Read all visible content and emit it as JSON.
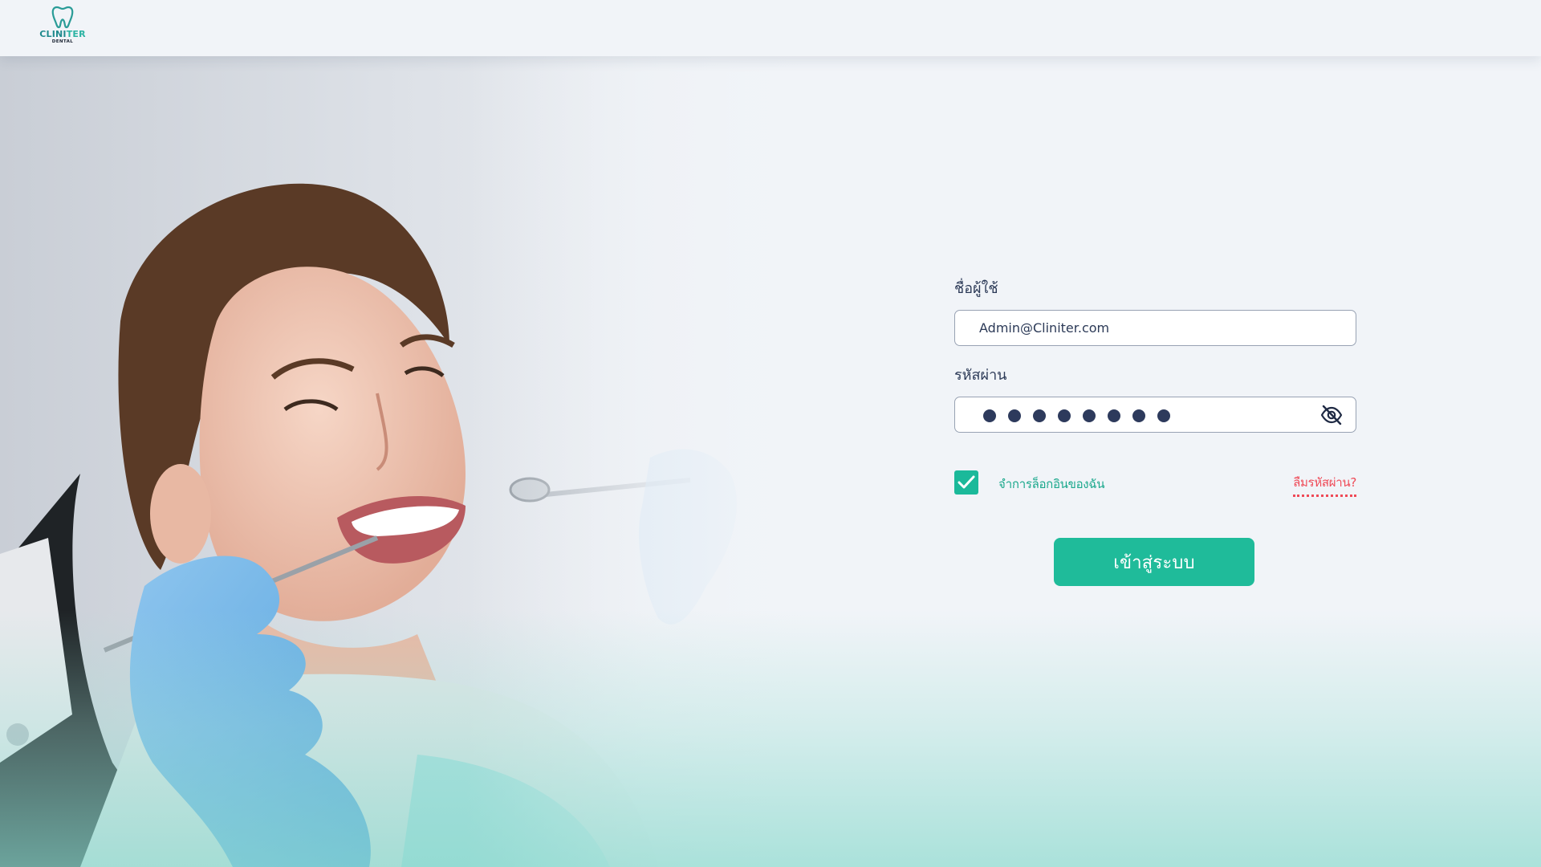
{
  "header": {
    "logo_name_main": "CLINI",
    "logo_name_accent": "TER",
    "logo_subtitle": "DENTAL"
  },
  "login": {
    "username_label": "ชื่อผู้ใช้",
    "username_value": "Admin@Cliniter.com",
    "password_label": "รหัสผ่าน",
    "password_mask_count": 8,
    "remember_label": "จำการล็อกอินของฉัน",
    "remember_checked": true,
    "forgot_label": "ลืมรหัสผ่าน?",
    "submit_label": "เข้าสู่ระบบ"
  },
  "colors": {
    "accent": "#1fbb9a",
    "link_red": "#ef4a57",
    "text_dark": "#2c3a57",
    "background": "#f1f4f8"
  },
  "icons": {
    "logo": "tooth-icon",
    "password_toggle": "eye-off-icon",
    "remember": "checkmark-icon"
  }
}
